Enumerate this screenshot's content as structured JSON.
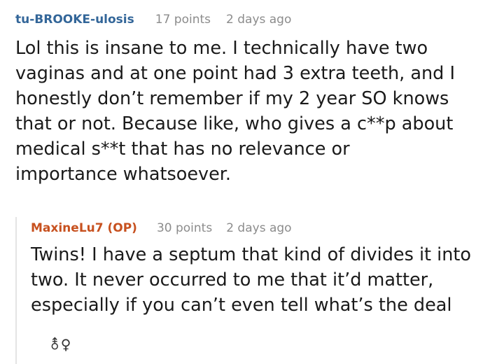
{
  "comments": [
    {
      "username": "tu-BROOKE-ulosis",
      "points": "17 points",
      "time": "2 days ago",
      "lines": [
        "Lol this is insane to me. I technically have two",
        "vaginas and at one point had 3 extra teeth, and I",
        "honestly don’t remember if my 2 year SO knows",
        "that or not. Because like, who gives a c**p about",
        "medical s**t that has no relevance or",
        "importance whatsoever."
      ]
    },
    {
      "username": "MaxineLu7 (OP)",
      "points": "30 points",
      "time": "2 days ago",
      "lines": [
        "Twins! I have a septum that kind of divides it into",
        "two. It never occurred to me that it’d matter,",
        "especially if you can’t even tell what’s the deal"
      ]
    }
  ],
  "footer_icon": {
    "name": "gender-icon",
    "glyph": "⚨♀"
  },
  "colors": {
    "username_primary": "#336699",
    "username_op": "#c7511f",
    "meta": "#8c8c8c",
    "body_text": "#1a1a1a"
  }
}
